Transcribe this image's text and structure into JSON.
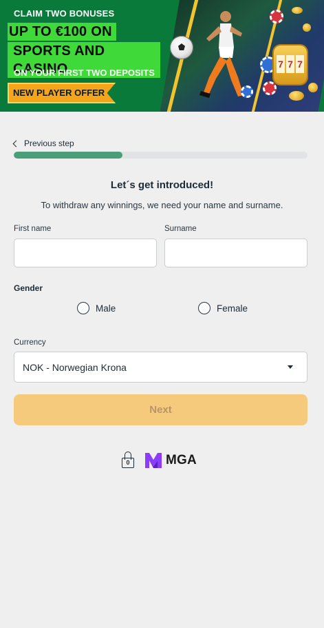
{
  "banner": {
    "claim_text": "CLAIM TWO BONUSES",
    "headline_line1": "UP TO €100 ON",
    "headline_line2": "SPORTS AND CASINO",
    "sub_text": "ON YOUR FIRST TWO DEPOSITS",
    "offer_badge": "NEW PLAYER OFFER",
    "colors": {
      "background": "#0a7a3b",
      "headline_bg": "#3fd93a",
      "offer_bg": "#f4a51c"
    }
  },
  "form": {
    "previous_step_label": "Previous step",
    "progress_fraction": 0.37,
    "title": "Let´s get introduced!",
    "subtitle": "To withdraw any winnings, we need your name and surname.",
    "first_name": {
      "label": "First name",
      "value": "",
      "placeholder": ""
    },
    "surname": {
      "label": "Surname",
      "value": "",
      "placeholder": ""
    },
    "gender": {
      "label": "Gender",
      "options": [
        "Male",
        "Female"
      ]
    },
    "currency": {
      "label": "Currency",
      "selected": "NOK - Norwegian Krona"
    },
    "next_label": "Next"
  },
  "footer": {
    "lock_digit": "0",
    "mga_text": "MGA"
  },
  "theme": {
    "accent_green": "#4a9f79",
    "next_button_bg": "#f6ca7d",
    "mga_purple": "#8b3dff"
  }
}
